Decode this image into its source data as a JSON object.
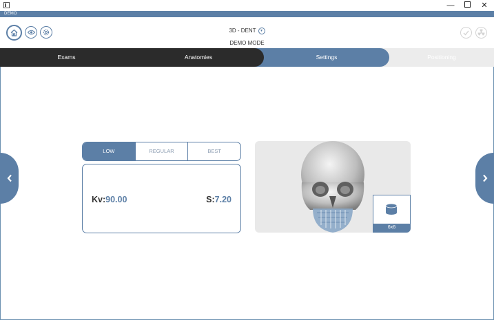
{
  "window": {
    "title": "",
    "minimize": "—",
    "close": "✕"
  },
  "demo_strip": {
    "label": "DEMO"
  },
  "header": {
    "title": "3D - DENT",
    "subtitle": "DEMO MODE"
  },
  "tabs": [
    {
      "label": "Exams",
      "active": false
    },
    {
      "label": "Anatomies",
      "active": false
    },
    {
      "label": "Settings",
      "active": true
    },
    {
      "label": "Positioning",
      "active": false,
      "disabled": true
    }
  ],
  "quality": {
    "options": [
      "LOW",
      "REGULAR",
      "BEST"
    ],
    "selected": "LOW"
  },
  "exposure": {
    "kv_label": "Kv:",
    "kv_value": "90.00",
    "s_label": "S:",
    "s_value": "7.20"
  },
  "preview": {
    "fov_label": "6x6"
  },
  "colors": {
    "accent": "#5c7fa6",
    "dark_tab": "#2b2b2b",
    "inactive_tab": "#ececec",
    "preview_bg": "#e9e9e9"
  },
  "icons": {
    "home": "home-icon",
    "eye": "eye-icon",
    "settings": "gear-icon",
    "confirm": "check-icon",
    "radiation": "radiation-icon",
    "prev": "chevron-left-icon",
    "next": "chevron-right-icon"
  }
}
